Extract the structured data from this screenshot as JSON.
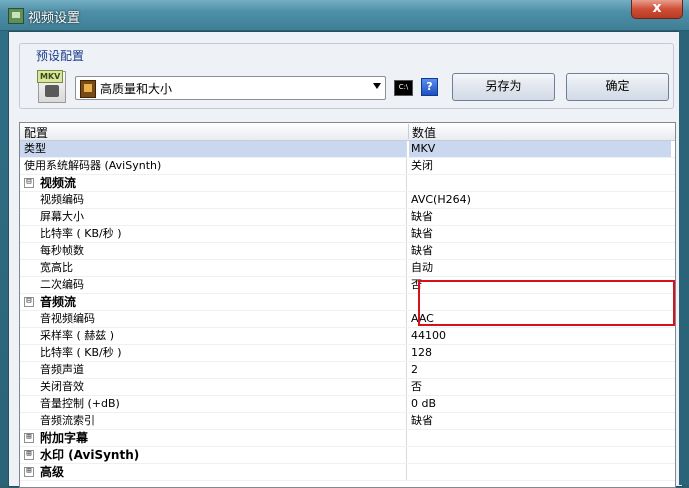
{
  "window": {
    "title": "视频设置",
    "close_label": "x"
  },
  "preset": {
    "group_label": "预设配置",
    "icon_tag": "MKV",
    "selected": "高质量和大小",
    "cmd_icon_label": "C:\\",
    "help_label": "?",
    "save_as_label": "另存为",
    "ok_label": "确定"
  },
  "grid": {
    "header_key": "配置",
    "header_value": "数值",
    "rows": [
      {
        "key": "类型",
        "value": "MKV"
      },
      {
        "key": "使用系统解码器 (AviSynth)",
        "value": "关闭"
      },
      {
        "key": "视频流",
        "value": "",
        "expander": "⊟"
      },
      {
        "key": "视频编码",
        "value": "AVC(H264)"
      },
      {
        "key": "屏幕大小",
        "value": "缺省"
      },
      {
        "key": "比特率 ( KB/秒 )",
        "value": "缺省"
      },
      {
        "key": "每秒帧数",
        "value": "缺省"
      },
      {
        "key": "宽高比",
        "value": "自动"
      },
      {
        "key": "二次编码",
        "value": "否"
      },
      {
        "key": "音频流",
        "value": "",
        "expander": "⊟"
      },
      {
        "key": "音视频编码",
        "value": "AAC"
      },
      {
        "key": "采样率 ( 赫兹 )",
        "value": "44100"
      },
      {
        "key": "比特率 ( KB/秒 )",
        "value": "128"
      },
      {
        "key": "音频声道",
        "value": "2"
      },
      {
        "key": "关闭音效",
        "value": "否"
      },
      {
        "key": "音量控制 (+dB)",
        "value": "0 dB"
      },
      {
        "key": "音频流索引",
        "value": "缺省"
      },
      {
        "key": "附加字幕",
        "value": "",
        "expander": "⊞"
      },
      {
        "key": "水印 (AviSynth)",
        "value": "",
        "expander": "⊞"
      },
      {
        "key": "高级",
        "value": "",
        "expander": "⊞"
      }
    ]
  },
  "colors": {
    "highlight_box": "#d9101a",
    "selected_row": "#c9d8ef"
  }
}
